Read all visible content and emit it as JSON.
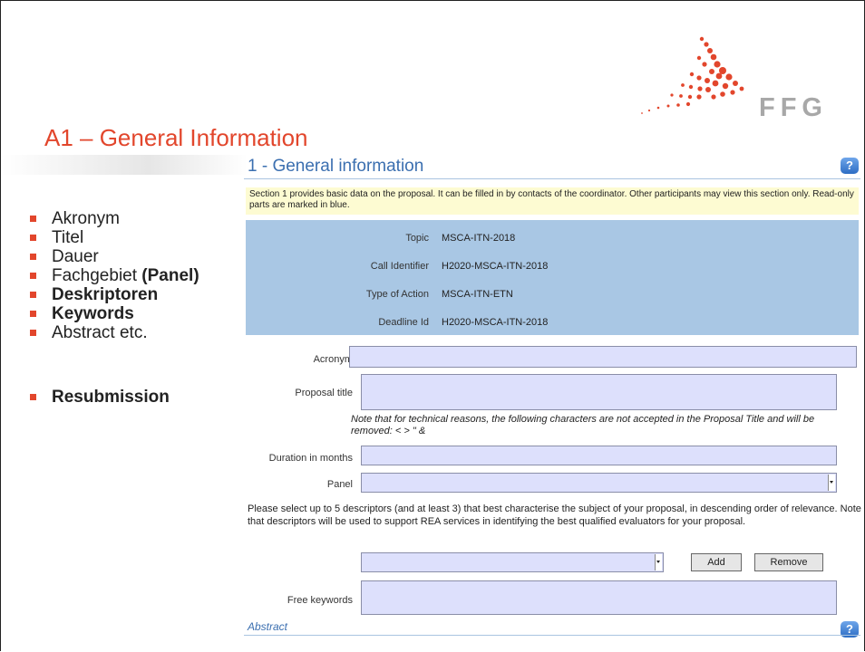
{
  "slide": {
    "title": "A1 – General Information",
    "logo_text": "FFG",
    "bullets": [
      {
        "text": "Akronym",
        "bold": false
      },
      {
        "text": "Titel",
        "bold": false
      },
      {
        "text": "Dauer",
        "bold": false
      },
      {
        "text_plain": "Fachgebiet ",
        "text_bold": "(Panel)"
      },
      {
        "text": "Deskriptoren",
        "bold": true
      },
      {
        "text": "Keywords",
        "bold": true
      },
      {
        "text": "Abstract etc.",
        "bold": false
      },
      {
        "text": "Resubmission",
        "bold": true
      }
    ]
  },
  "form": {
    "section_title": "1 - General information",
    "help_label": "?",
    "intro_note": "Section 1 provides basic data on the proposal. It can be filled in by contacts of the coordinator.  Other participants may view this section only.  Read-only parts are marked in blue.",
    "readonly": [
      {
        "label": "Topic",
        "value": "MSCA-ITN-2018"
      },
      {
        "label": "Call Identifier",
        "value": "H2020-MSCA-ITN-2018"
      },
      {
        "label": "Type of Action",
        "value": "MSCA-ITN-ETN"
      },
      {
        "label": "Deadline Id",
        "value": "H2020-MSCA-ITN-2018"
      }
    ],
    "acronym_label": "Acronym",
    "acronym_value": "",
    "title_label": "Proposal title",
    "title_value": "",
    "title_note": "Note that for technical reasons, the following characters are not accepted in the Proposal Title and will be removed: < > \" &",
    "duration_label": "Duration in months",
    "duration_value": "",
    "panel_label": "Panel",
    "panel_value": "",
    "descriptors_note": "Please select up to 5 descriptors (and at least 3) that best characterise the subject of your proposal, in descending order of relevance. Note that descriptors will be used to support REA services in identifying the best qualified evaluators for your proposal.",
    "descriptor_value": "",
    "add_label": "Add",
    "remove_label": "Remove",
    "keywords_label": "Free keywords",
    "keywords_value": "",
    "abstract_label": "Abstract"
  }
}
